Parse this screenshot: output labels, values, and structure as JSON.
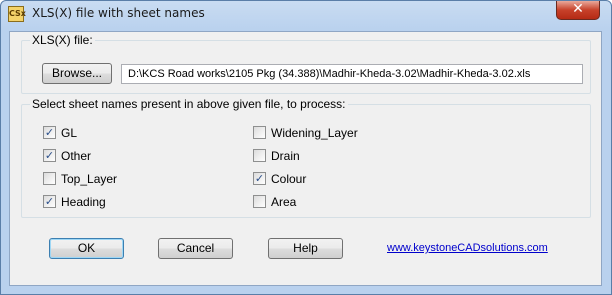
{
  "window": {
    "title": "XLS(X) file with sheet names",
    "icon_text": "CSx",
    "close_glyph": "✕"
  },
  "file_group": {
    "label": "XLS(X) file:",
    "browse_label": "Browse...",
    "path_value": "D:\\KCS Road works\\2105 Pkg (34.388)\\Madhir-Kheda-3.02\\Madhir-Kheda-3.02.xls"
  },
  "sheets_group": {
    "label": "Select sheet names present in above given file, to process:",
    "items": [
      {
        "label": "GL",
        "checked": true
      },
      {
        "label": "Other",
        "checked": true
      },
      {
        "label": "Top_Layer",
        "checked": false
      },
      {
        "label": "Heading",
        "checked": true
      },
      {
        "label": "Widening_Layer",
        "checked": false
      },
      {
        "label": "Drain",
        "checked": false
      },
      {
        "label": "Colour",
        "checked": true
      },
      {
        "label": "Area",
        "checked": false
      }
    ]
  },
  "footer": {
    "ok_label": "OK",
    "cancel_label": "Cancel",
    "help_label": "Help",
    "link_text": "www.keystoneCADsolutions.com"
  },
  "colors": {
    "title_gradient": "#c9dcf2",
    "close_red": "#c7412a",
    "link": "#0000cc",
    "default_button_border": "#3c7fb1"
  }
}
